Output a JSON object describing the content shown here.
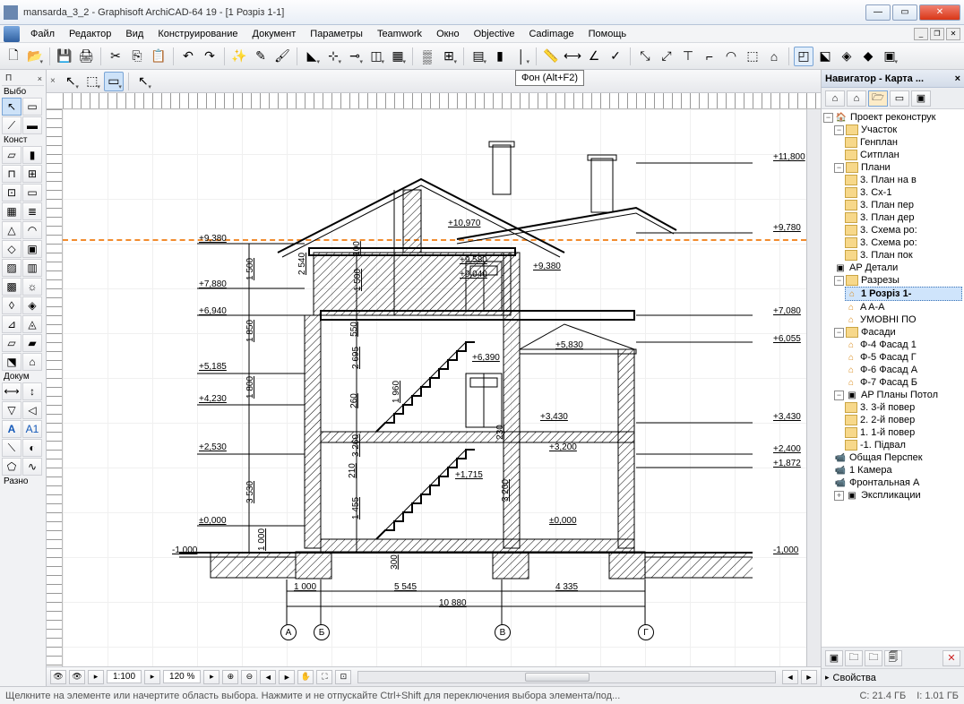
{
  "window": {
    "title": "mansarda_3_2 - Graphisoft ArchiCAD-64 19 - [1 Розріз 1-1]"
  },
  "menu": [
    "Файл",
    "Редактор",
    "Вид",
    "Конструирование",
    "Документ",
    "Параметры",
    "Teamwork",
    "Окно",
    "Objective",
    "Cadimage",
    "Помощь"
  ],
  "tooltip": "Фон (Alt+F2)",
  "left_panels": {
    "p1": "П",
    "p2": "Выбо",
    "p3": "Конст",
    "p4": "Докум",
    "p5": "Разно"
  },
  "viewbar": {
    "scale": "1:100",
    "zoom": "120 %"
  },
  "status": {
    "hint": "Щелкните на элементе или начертите область выбора. Нажмите и не отпускайте Ctrl+Shift для переключения выбора элемента/под...",
    "c": "C: 21.4 ГБ",
    "i": "I: 1.01 ГБ"
  },
  "navigator": {
    "title": "Навигатор - Карта ...",
    "project": "Проект реконструк",
    "uchastok": "Участок",
    "genplan": "Генплан",
    "sitplan": "Ситплан",
    "plany": "Плани",
    "plan3": "3. План на в",
    "plan3cx": "3. Сх-1",
    "plan3per": "3. План пер",
    "plan3der": "3. План дер",
    "plan3sx": "3. Схема ро:",
    "plan3sx2": "3. Схема ро:",
    "plan3pok": "3. План пок",
    "ar_det": "AP Детали",
    "razrezy": "Разрезы",
    "r1": "1 Розріз 1-",
    "aa": "A A-A",
    "umov": "УМОВНІ ПО",
    "fasady": "Фасади",
    "f4": "Ф-4 Фасад 1",
    "f5": "Ф-5 Фасад Г",
    "f6": "Ф-6 Фасад А",
    "f7": "Ф-7 Фасад Б",
    "ar_potol": "AP Планы Потол",
    "p3y": "3. 3-й повер",
    "p2y": "2. 2-й повер",
    "p1y": "1. 1-й повер",
    "pm1": "-1. Підвал",
    "persp": "Общая Перспек",
    "cam1": "1 Камера",
    "front": "Фронтальная А",
    "ekspl": "Экспликации",
    "props": "Свойства"
  },
  "labels": {
    "e11800": "+11,800",
    "e9780": "+9,780",
    "e9380l": "+9,380",
    "e10970": "+10,970",
    "e9580": "+9,580",
    "e9040": "+9,040",
    "e9380r": "+9,380",
    "e7880": "+7,880",
    "e6940": "+6,940",
    "e7080": "+7,080",
    "e6055": "+6,055",
    "e5185": "+5,185",
    "e4230": "+4,230",
    "e5830": "+5,830",
    "e6390": "+6,390",
    "e3430l": "+3,430",
    "e3430r": "+3,430",
    "e3200": "+3,200",
    "e2400": "+2,400",
    "e1872": "+1,872",
    "e2530": "+2,530",
    "e1715": "+1,715",
    "e0l": "±0,000",
    "e0r": "±0,000",
    "em1l": "-1,000",
    "em1r": "-1,000",
    "d1500": "1 500",
    "d1500b": "1 500",
    "d100": "100",
    "d2540": "2 540",
    "d1850": "1 850",
    "d1800": "1 800",
    "d2695": "2 695",
    "d550": "550",
    "d260": "260",
    "d1960": "1 960",
    "d3260": "3 260",
    "d210": "210",
    "d1455": "1 455",
    "d3530": "3 530",
    "d1000v": "1 000",
    "d230": "230",
    "d3200": "3 200",
    "d300": "300",
    "d1000": "1 000",
    "d5545": "5 545",
    "d4335": "4 335",
    "d10880": "10 880",
    "axA": "А",
    "axB": "Б",
    "axV": "В",
    "axG": "Г"
  }
}
